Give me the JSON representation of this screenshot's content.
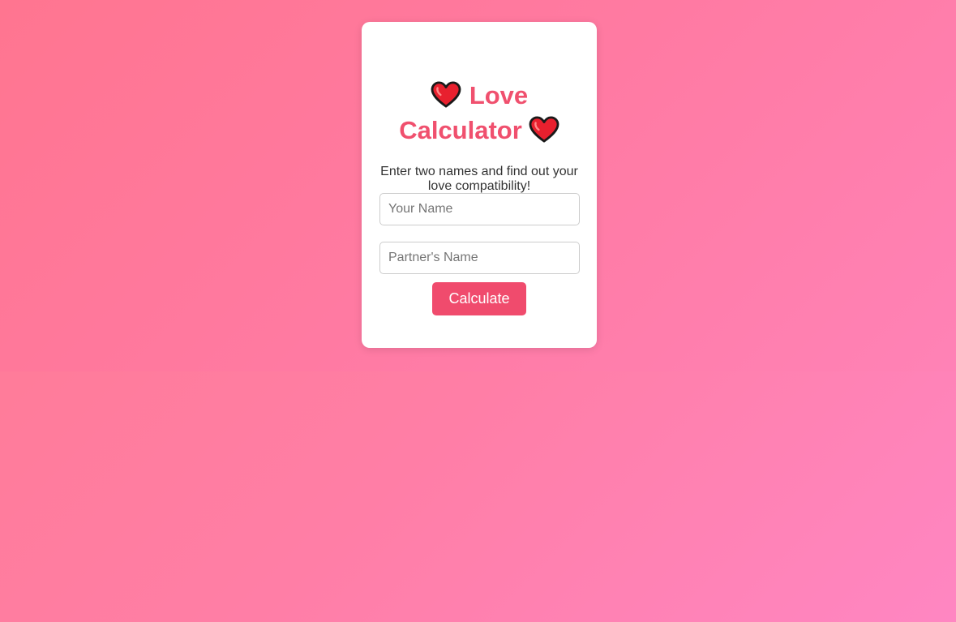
{
  "card": {
    "title_line1": "Love",
    "title_line2": "Calculator",
    "subtitle": "Enter two names and find out your love compatibility!",
    "your_name_placeholder": "Your Name",
    "your_name_value": "",
    "partner_name_placeholder": "Partner's Name",
    "partner_name_value": "",
    "calculate_label": "Calculate"
  },
  "icons": {
    "title_left": "heart-icon",
    "title_right": "heart-icon"
  },
  "colors": {
    "accent": "#f04b6d",
    "title": "#f0506e",
    "background_start": "#ff7590",
    "background_end": "#ff86c2",
    "heart_fill": "#e8202e",
    "heart_outline": "#1a1a1a"
  }
}
